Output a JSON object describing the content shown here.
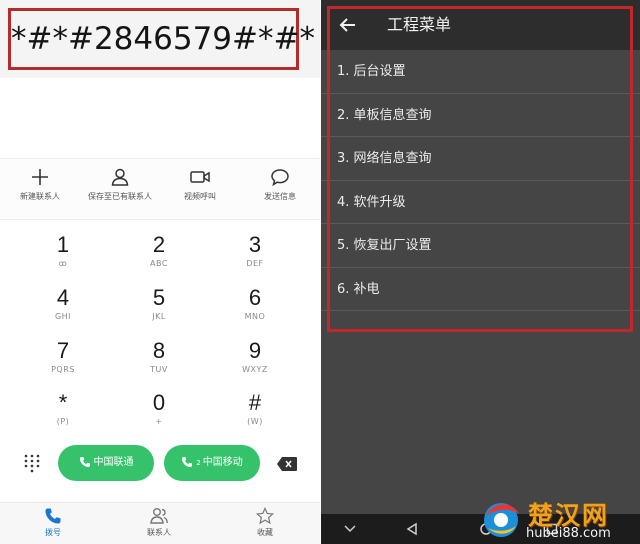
{
  "dialer": {
    "code": "*#*#2846579#*#*",
    "actions": [
      {
        "label": "新建联系人",
        "icon": "plus-icon"
      },
      {
        "label": "保存至已有联系人",
        "icon": "person-icon"
      },
      {
        "label": "视频呼叫",
        "icon": "video-icon"
      },
      {
        "label": "发送信息",
        "icon": "message-icon"
      }
    ],
    "keys": [
      {
        "digit": "1",
        "sub": "ꝏ"
      },
      {
        "digit": "2",
        "sub": "ABC"
      },
      {
        "digit": "3",
        "sub": "DEF"
      },
      {
        "digit": "4",
        "sub": "GHI"
      },
      {
        "digit": "5",
        "sub": "JKL"
      },
      {
        "digit": "6",
        "sub": "MNO"
      },
      {
        "digit": "7",
        "sub": "PQRS"
      },
      {
        "digit": "8",
        "sub": "TUV"
      },
      {
        "digit": "9",
        "sub": "WXYZ"
      },
      {
        "digit": "*",
        "sub": "(P)"
      },
      {
        "digit": "0",
        "sub": "+"
      },
      {
        "digit": "#",
        "sub": "(W)"
      }
    ],
    "sim1_label": "中国联通",
    "sim2_label": "中国移动",
    "sim2_badge": "2",
    "nav": [
      {
        "label": "拨号",
        "icon": "phone-icon",
        "active": true
      },
      {
        "label": "联系人",
        "icon": "contacts-icon",
        "active": false
      },
      {
        "label": "收藏",
        "icon": "star-icon",
        "active": false
      }
    ],
    "accent_color": "#1976d2",
    "call_color": "#35c26a"
  },
  "engineering_menu": {
    "title": "工程菜单",
    "items": [
      "1. 后台设置",
      "2. 单板信息查询",
      "3. 网络信息查询",
      "4. 软件升级",
      "5. 恢复出厂设置",
      "6. 补电"
    ],
    "highlight_color": "#c0282b"
  },
  "watermark": {
    "text": "楚汉网",
    "url": "hubei88.com"
  }
}
